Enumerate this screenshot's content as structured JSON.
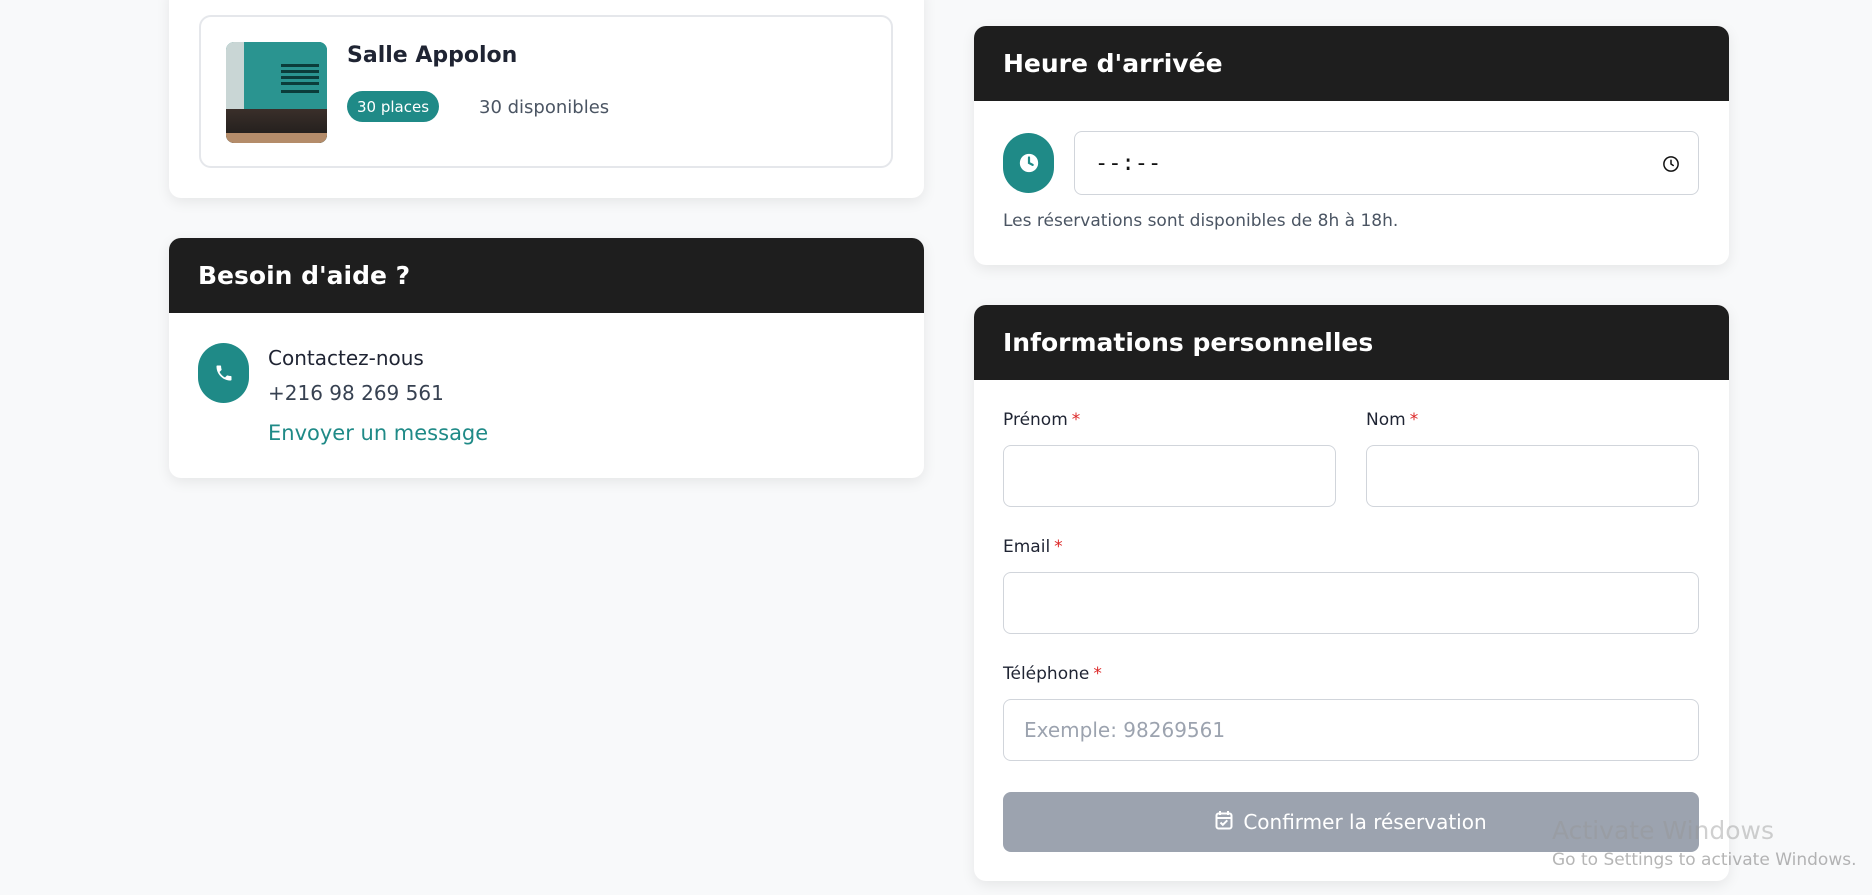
{
  "room": {
    "name": "Salle Appolon",
    "capacity_badge": "30 places",
    "availability": "30 disponibles"
  },
  "help": {
    "title": "Besoin d'aide ?",
    "contact_title": "Contactez-nous",
    "phone": "+216 98 269 561",
    "message_link": "Envoyer un message"
  },
  "arrival": {
    "title": "Heure d'arrivée",
    "time_value": "--:--",
    "hint": "Les réservations sont disponibles de 8h à 18h."
  },
  "personal": {
    "title": "Informations personnelles",
    "firstname_label": "Prénom",
    "lastname_label": "Nom",
    "email_label": "Email",
    "phone_label": "Téléphone",
    "required_mark": "*",
    "phone_placeholder": "Exemple: 98269561",
    "firstname_value": "",
    "lastname_value": "",
    "email_value": ""
  },
  "confirm_button": "Confirmer la réservation",
  "watermark": {
    "title": "Activate Windows",
    "subtitle": "Go to Settings to activate Windows."
  },
  "colors": {
    "accent": "#1f8a87",
    "header": "#1e1e1e",
    "disabled_button": "#9ca3af",
    "required": "#dc2626"
  }
}
